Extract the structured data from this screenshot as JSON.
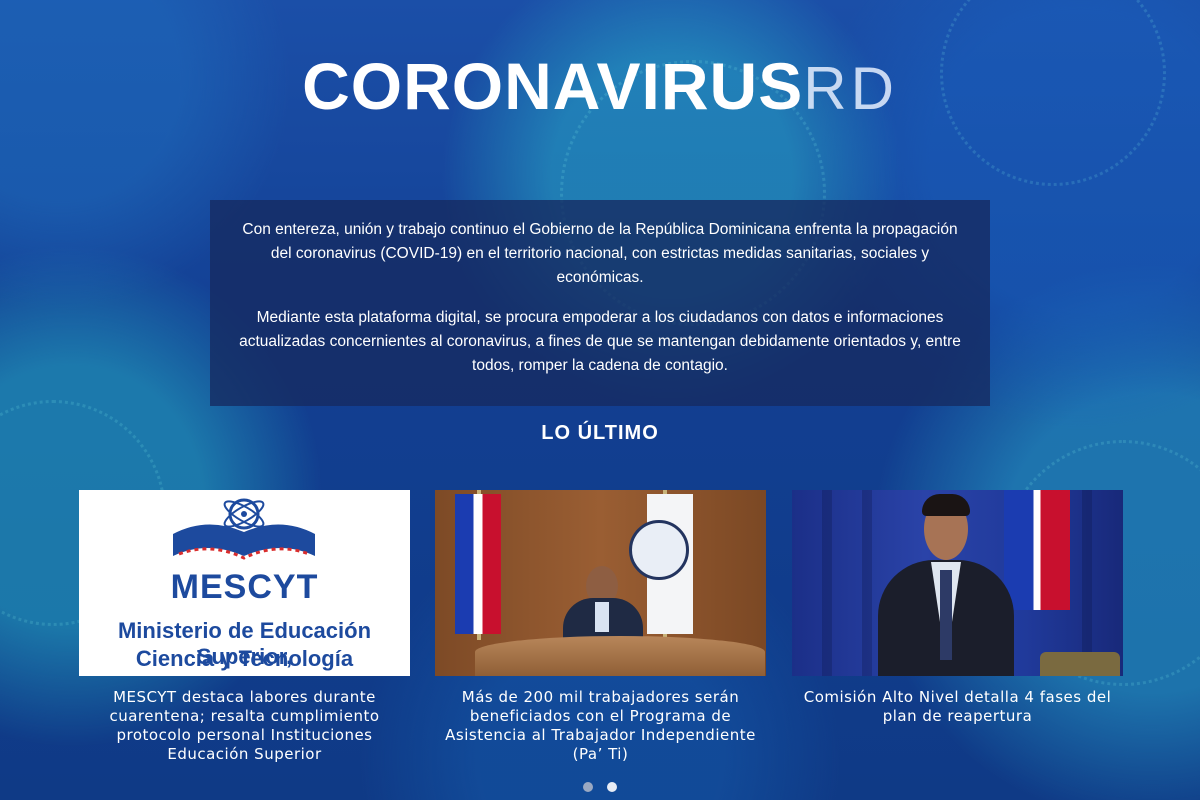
{
  "header": {
    "title_strong": "CORONAVIRUS",
    "title_thin": "RD"
  },
  "intro": {
    "paragraph_1": "Con entereza, unión y trabajo continuo el Gobierno de la República Dominicana enfrenta la propagación del coronavirus (COVID-19) en el territorio nacional, con estrictas medidas sanitarias, sociales y económicas.",
    "paragraph_2": "Mediante esta plataforma digital, se procura empoderar a los ciudadanos con datos e informaciones actualizadas concernientes al coronavirus, a fines de que se mantengan debidamente orientados y, entre todos, romper la cadena de contagio."
  },
  "latest": {
    "heading": "LO ÚLTIMO",
    "cards": [
      {
        "caption": "MESCYT destaca labores durante cuarentena; resalta cumplimiento protocolo personal Instituciones Educación Superior",
        "logo_word": "MESCYT",
        "logo_sub_line_1": "Ministerio de Educación Superior,",
        "logo_sub_line_2": "Ciencia y Tecnología"
      },
      {
        "caption": "Más de 200 mil trabajadores serán beneficiados con el Programa de Asistencia al Trabajador Independiente (Pa’ Ti)"
      },
      {
        "caption": "Comisión Alto Nivel detalla 4 fases del plan de reapertura"
      }
    ],
    "carousel": {
      "page_count": 2,
      "active_page": 2
    }
  },
  "colors": {
    "background": "#123f92",
    "intro_panel": "#162a60",
    "brand_blue": "#1d4a9e",
    "text": "#ffffff"
  }
}
